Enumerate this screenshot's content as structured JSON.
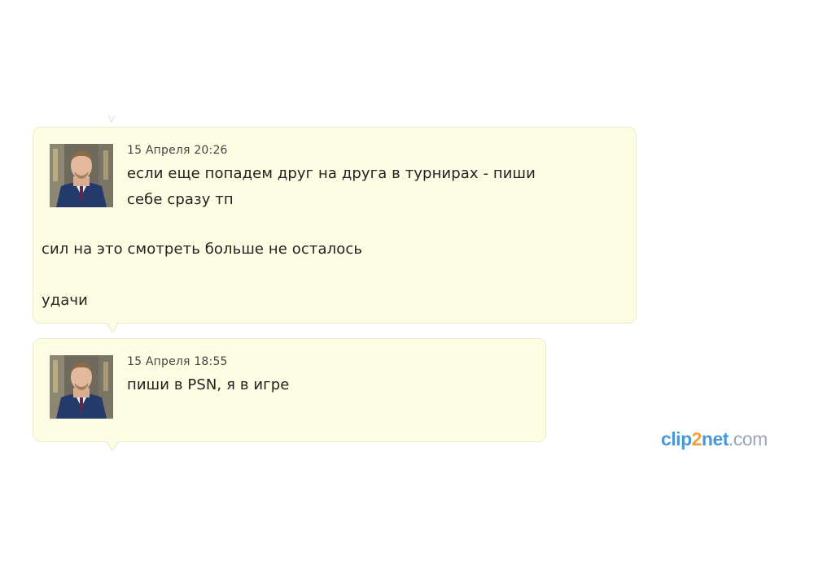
{
  "messages": [
    {
      "timestamp": "15 Апреля 20:26",
      "lines": [
        "если еще попадем друг на друга в турнирах - пиши",
        "себе сразу тп",
        "сил на это смотреть больше не осталось",
        "удачи"
      ]
    },
    {
      "timestamp": "15 Апреля 18:55",
      "lines": [
        "пиши в PSN, я в игре"
      ]
    }
  ],
  "watermark": {
    "part_a": "clip",
    "part_2": "2",
    "part_b": "net",
    "part_c": ".com"
  },
  "colors": {
    "bubble_bg": "#fdfde4",
    "bubble_border": "#ececcc",
    "watermark_blue": "#4a97d8",
    "watermark_orange": "#f4a03a"
  }
}
